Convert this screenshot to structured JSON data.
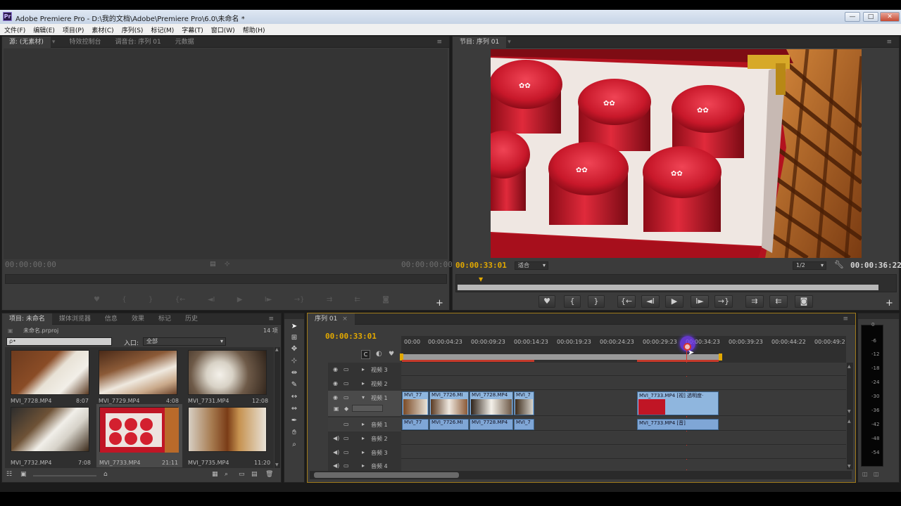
{
  "window": {
    "logo": "Pr",
    "title": "Adobe Premiere Pro - D:\\我的文档\\Adobe\\Premiere Pro\\6.0\\未命名 *",
    "minimize": "—",
    "maximize": "□",
    "close": "✕"
  },
  "menu": [
    "文件(F)",
    "编辑(E)",
    "项目(P)",
    "素材(C)",
    "序列(S)",
    "标记(M)",
    "字幕(T)",
    "窗口(W)",
    "帮助(H)"
  ],
  "source_panel": {
    "tabs": [
      "源: (无素材)",
      "特效控制台",
      "调音台: 序列 01",
      "元数据"
    ],
    "tc_left": "00:00:00:00",
    "tc_right": "00:00:00:00",
    "add": "+"
  },
  "program_panel": {
    "tab": "节目: 序列 01",
    "tc_current": "00:00:33:01",
    "fit": "适合",
    "resolution": "1/2",
    "tc_duration": "00:00:36:22",
    "controls": [
      "♥",
      "{",
      "}",
      "{←",
      "◄I",
      "▶",
      "I►",
      "→}",
      "⇉",
      "⇇",
      "◙"
    ],
    "add": "+"
  },
  "project_panel": {
    "tabs": [
      "项目: 未命名",
      "媒体浏览器",
      "信息",
      "效果",
      "标记",
      "历史"
    ],
    "project_file": "未命名.prproj",
    "item_count": "14 项",
    "search_placeholder": "ρ•",
    "entry_label": "入口:",
    "entry_value": "全部",
    "clips": [
      {
        "name": "MVI_7728.MP4",
        "duration": "8:07"
      },
      {
        "name": "MVI_7729.MP4",
        "duration": "4:08"
      },
      {
        "name": "MVI_7731.MP4",
        "duration": "12:08"
      },
      {
        "name": "MVI_7732.MP4",
        "duration": "7:08"
      },
      {
        "name": "MVI_7733.MP4",
        "duration": "21:11"
      },
      {
        "name": "MVI_7735.MP4",
        "duration": "11:20"
      }
    ]
  },
  "timeline": {
    "tab": "序列 01",
    "tc": "00:00:33:01",
    "ruler": [
      "00:00",
      "00:00:04:23",
      "00:00:09:23",
      "00:00:14:23",
      "00:00:19:23",
      "00:00:24:23",
      "00:00:29:23",
      "00:00:34:23",
      "00:00:39:23",
      "00:00:44:22",
      "00:00:49:2"
    ],
    "tracks": {
      "v3": "视频 3",
      "v2": "视频 2",
      "v1": "视频 1",
      "a1": "音频 1",
      "a2": "音频 2",
      "a3": "音频 3",
      "a4": "音频 4"
    },
    "video_clips": [
      "MVI_77",
      "MVI_7726.MI",
      "MVI_7728.MP4",
      "MVI_7",
      "MVI_7733.MP4 [视] 透明度·"
    ],
    "audio_clips": [
      "MVI_77",
      "MVI_7726.MI",
      "MVI_7728.MP4",
      "MVI_7",
      "MVI_7733.MP4 [音]"
    ]
  },
  "audio_meter": {
    "ticks": [
      "0",
      "-6",
      "-12",
      "-18",
      "-24",
      "-30",
      "-36",
      "-42",
      "-48",
      "-54"
    ]
  },
  "colors": {
    "timecode": "#e3a900",
    "playhead": "#d9342b",
    "clip_blue": "#8fb6de",
    "panel_bg": "#3b3b3b"
  }
}
